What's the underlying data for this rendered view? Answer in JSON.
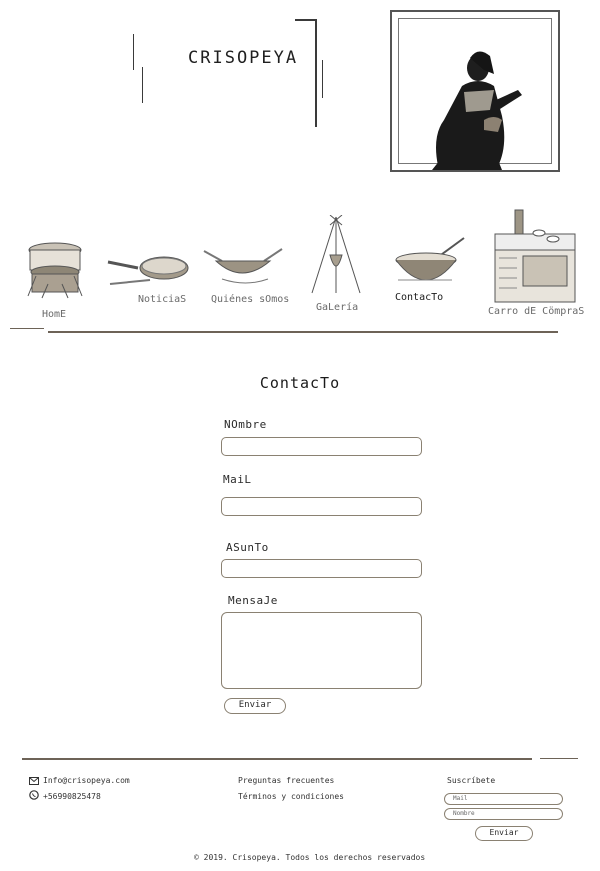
{
  "header": {
    "logo": "CRISOPEYA"
  },
  "nav": [
    {
      "label": "HomE",
      "active": false
    },
    {
      "label": "NoticiaS",
      "active": false
    },
    {
      "label": "Quiénes sOmos",
      "active": false
    },
    {
      "label": "GaLería",
      "active": false
    },
    {
      "label": "ContacTo",
      "active": true
    },
    {
      "label": "Carro dE CömpraS",
      "active": false
    }
  ],
  "contact": {
    "title": "ContacTo",
    "name_label": "NOmbre",
    "mail_label": "MaiL",
    "subject_label": "ASunTo",
    "message_label": "MensaJe",
    "submit_label": "Enviar"
  },
  "footer": {
    "email": "Info@crisopeya.com",
    "phone": "+56990825478",
    "faq": "Preguntas frecuentes",
    "terms": "Términos y condiciones",
    "subscribe_title": "Suscríbete",
    "subscribe_mail_placeholder": "Mail",
    "subscribe_name_placeholder": "Nombre",
    "subscribe_button": "Enviar",
    "copyright": "© 2019. Crisopeya. Todos los derechos reservados"
  }
}
